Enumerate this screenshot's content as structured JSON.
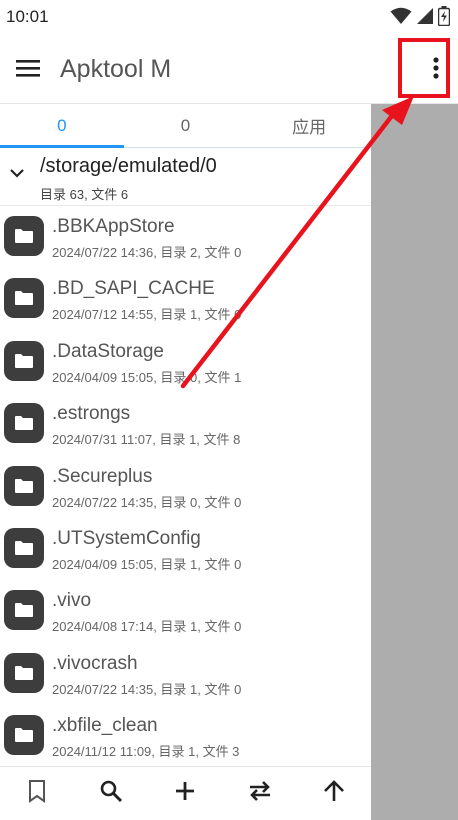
{
  "status_bar": {
    "time": "10:01",
    "icons": [
      "wifi-icon",
      "signal-icon",
      "battery-icon"
    ]
  },
  "app_bar": {
    "title": "Apktool M",
    "menu_icon": "hamburger-menu-icon",
    "more_icon": "more-vertical-icon"
  },
  "tabs": [
    {
      "label": "0",
      "active": true
    },
    {
      "label": "0",
      "active": false
    },
    {
      "label": "应用",
      "active": false
    }
  ],
  "path": {
    "current": "/storage/emulated/0",
    "meta": "目录 63, 文件 6"
  },
  "files": [
    {
      "name": ".BBKAppStore",
      "meta": "2024/07/22 14:36, 目录 2, 文件 0"
    },
    {
      "name": ".BD_SAPI_CACHE",
      "meta": "2024/07/12 14:55, 目录 1, 文件 0"
    },
    {
      "name": ".DataStorage",
      "meta": "2024/04/09 15:05, 目录 0, 文件 1"
    },
    {
      "name": ".estrongs",
      "meta": "2024/07/31 11:07, 目录 1, 文件 8"
    },
    {
      "name": ".Secureplus",
      "meta": "2024/07/22 14:35, 目录 0, 文件 0"
    },
    {
      "name": ".UTSystemConfig",
      "meta": "2024/04/09 15:05, 目录 1, 文件 0"
    },
    {
      "name": ".vivo",
      "meta": "2024/04/08 17:14, 目录 1, 文件 0"
    },
    {
      "name": ".vivocrash",
      "meta": "2024/07/22 14:35, 目录 1, 文件 0"
    },
    {
      "name": ".xbfile_clean",
      "meta": "2024/11/12 11:09, 目录 1, 文件 3"
    }
  ],
  "bottom_bar": [
    "bookmark-icon",
    "search-icon",
    "add-icon",
    "swap-icon",
    "arrow-up-icon"
  ],
  "colors": {
    "accent": "#2196f3",
    "annotation": "#e8131c",
    "scrim": "#adadad",
    "folder_icon_bg": "#3d3d3d"
  }
}
